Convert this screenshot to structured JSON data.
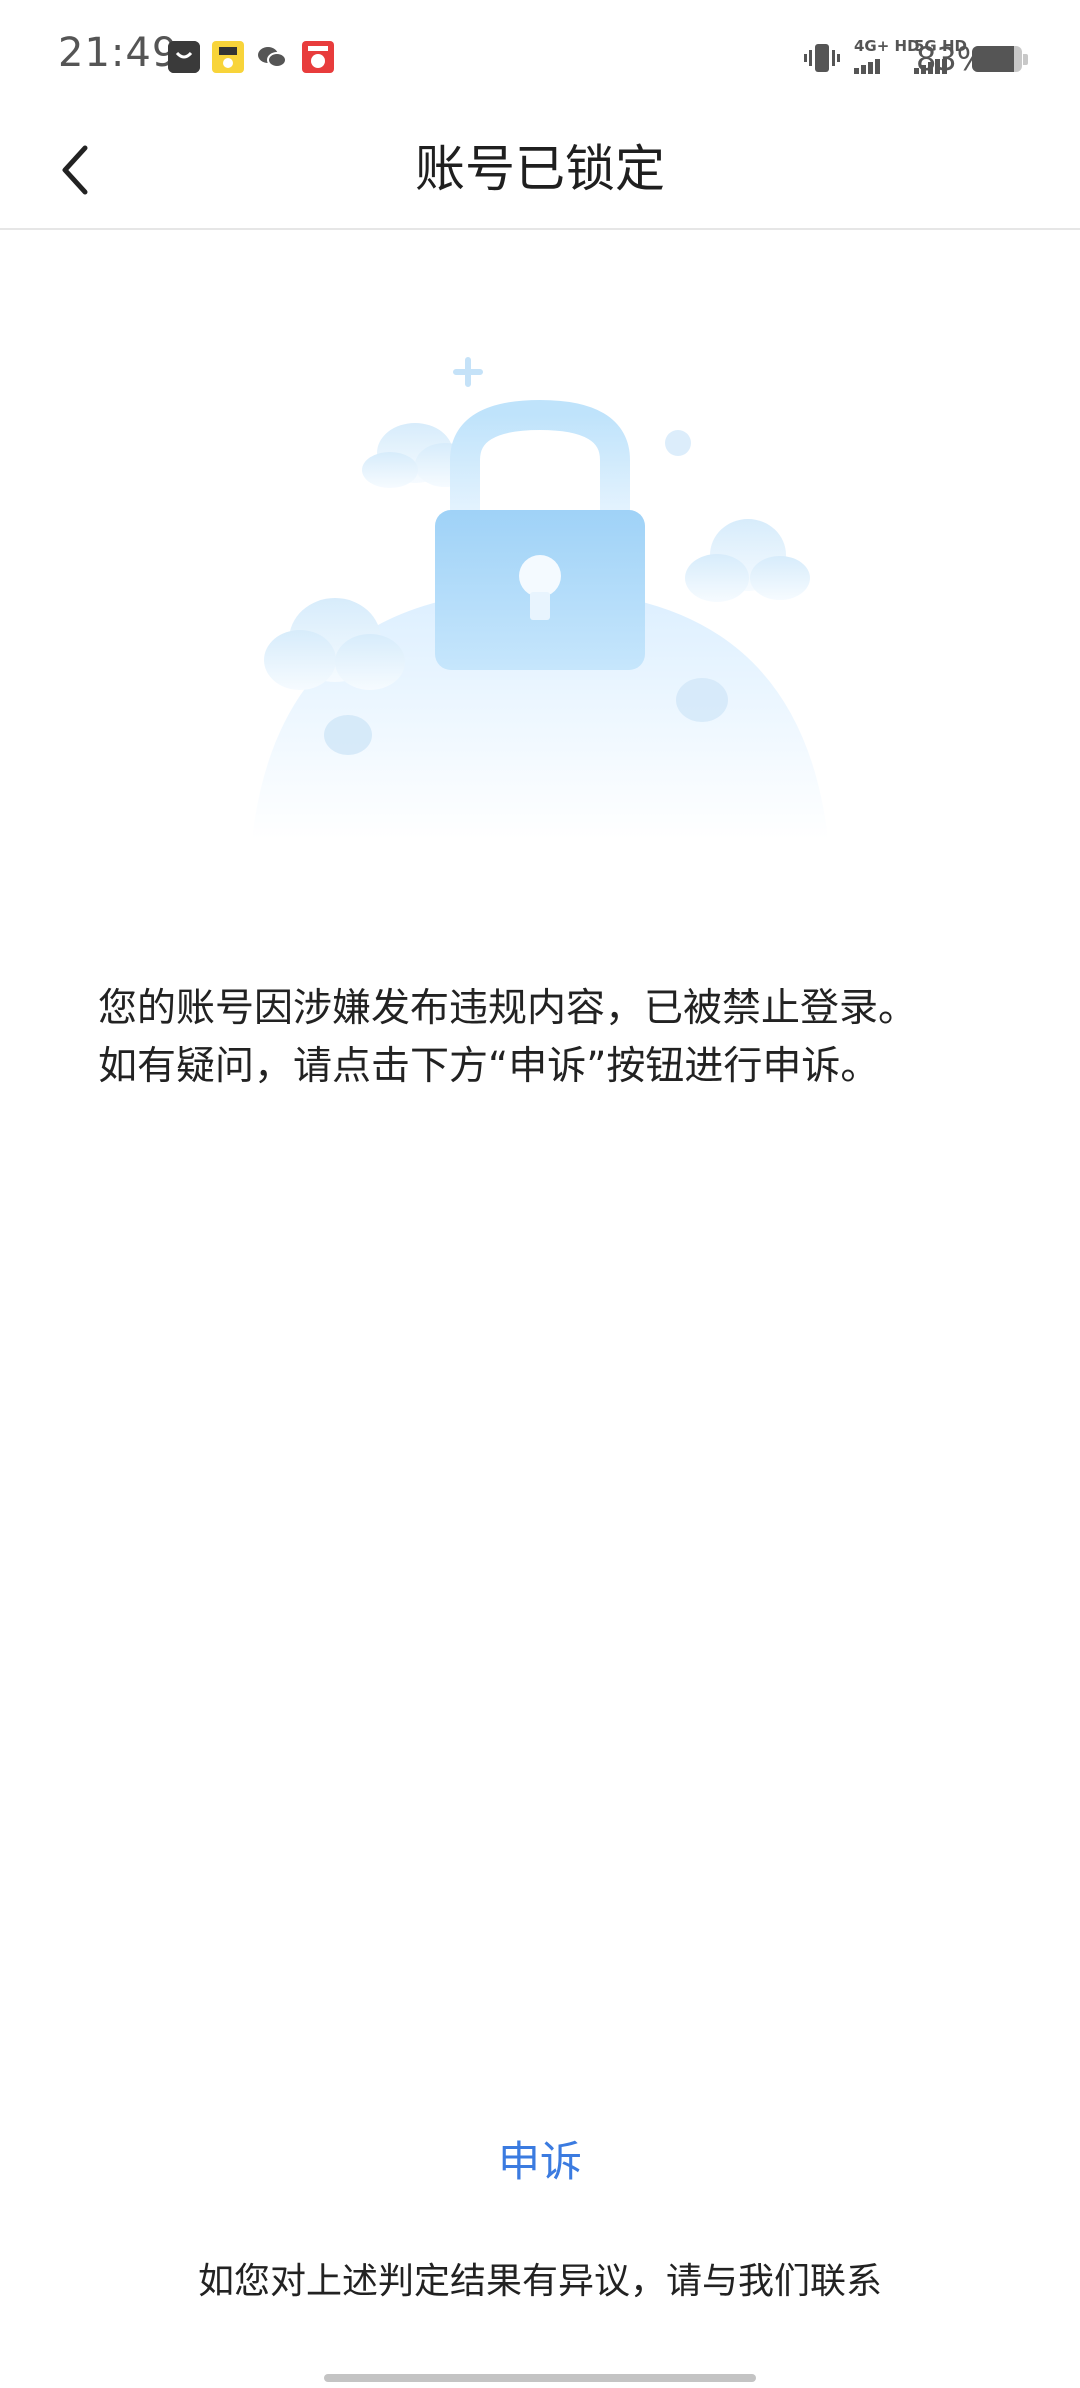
{
  "status_bar": {
    "time": "21:49",
    "net_4g": "4G+ HD",
    "net_5g": "5G HD",
    "battery": "83%",
    "battery_level": 0.83,
    "notification_icons": [
      "shopping-bag-icon",
      "game-app-icon",
      "wechat-icon",
      "news-app-icon"
    ]
  },
  "nav": {
    "back_icon": "chevron-left-icon",
    "title": "账号已锁定"
  },
  "illustration": {
    "icon": "padlock-illustration",
    "accent_color": "#bfe3fb"
  },
  "message": {
    "line1": "您的账号因涉嫌发布违规内容，已被禁止登录。",
    "line2": "如有疑问，请点击下方“申诉”按钮进行申诉。"
  },
  "footer": {
    "appeal_label": "申诉",
    "contact_text": "如您对上述判定结果有异议，请与我们联系",
    "link_color": "#3b7be0"
  }
}
